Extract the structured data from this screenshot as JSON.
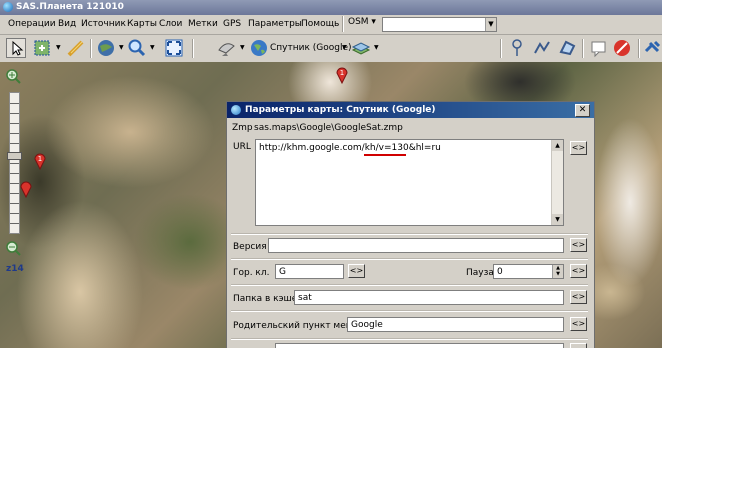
{
  "window": {
    "title": "SAS.Планета 121010"
  },
  "menu": {
    "items": [
      "Операции",
      "Вид",
      "Источник",
      "Карты",
      "Слои",
      "Метки",
      "GPS",
      "Параметры",
      "Помощь"
    ]
  },
  "toolbar": {
    "osm_label": "OSM",
    "map_label": "Спутник (Google)",
    "search_value": ""
  },
  "zoom": {
    "level": "z14"
  },
  "dialog": {
    "title": "Параметры карты: Спутник (Google)",
    "zmp_label": "Zmp",
    "zmp_path": "sas.maps\\Google\\GoogleSat.zmp",
    "url_label": "URL",
    "url_value": "http://khm.google.com/kh/v=130&hl=ru",
    "version_label": "Версия",
    "version_value": "",
    "hotkey_label": "Гор. кл.",
    "hotkey_value": "G",
    "pause_label": "Пауза",
    "pause_value": "0",
    "cache_folder_label": "Папка в кэше",
    "cache_folder_value": "sat",
    "parent_menu_label": "Родительский пункт меню",
    "parent_menu_value": "Google",
    "button_label": "<>"
  }
}
